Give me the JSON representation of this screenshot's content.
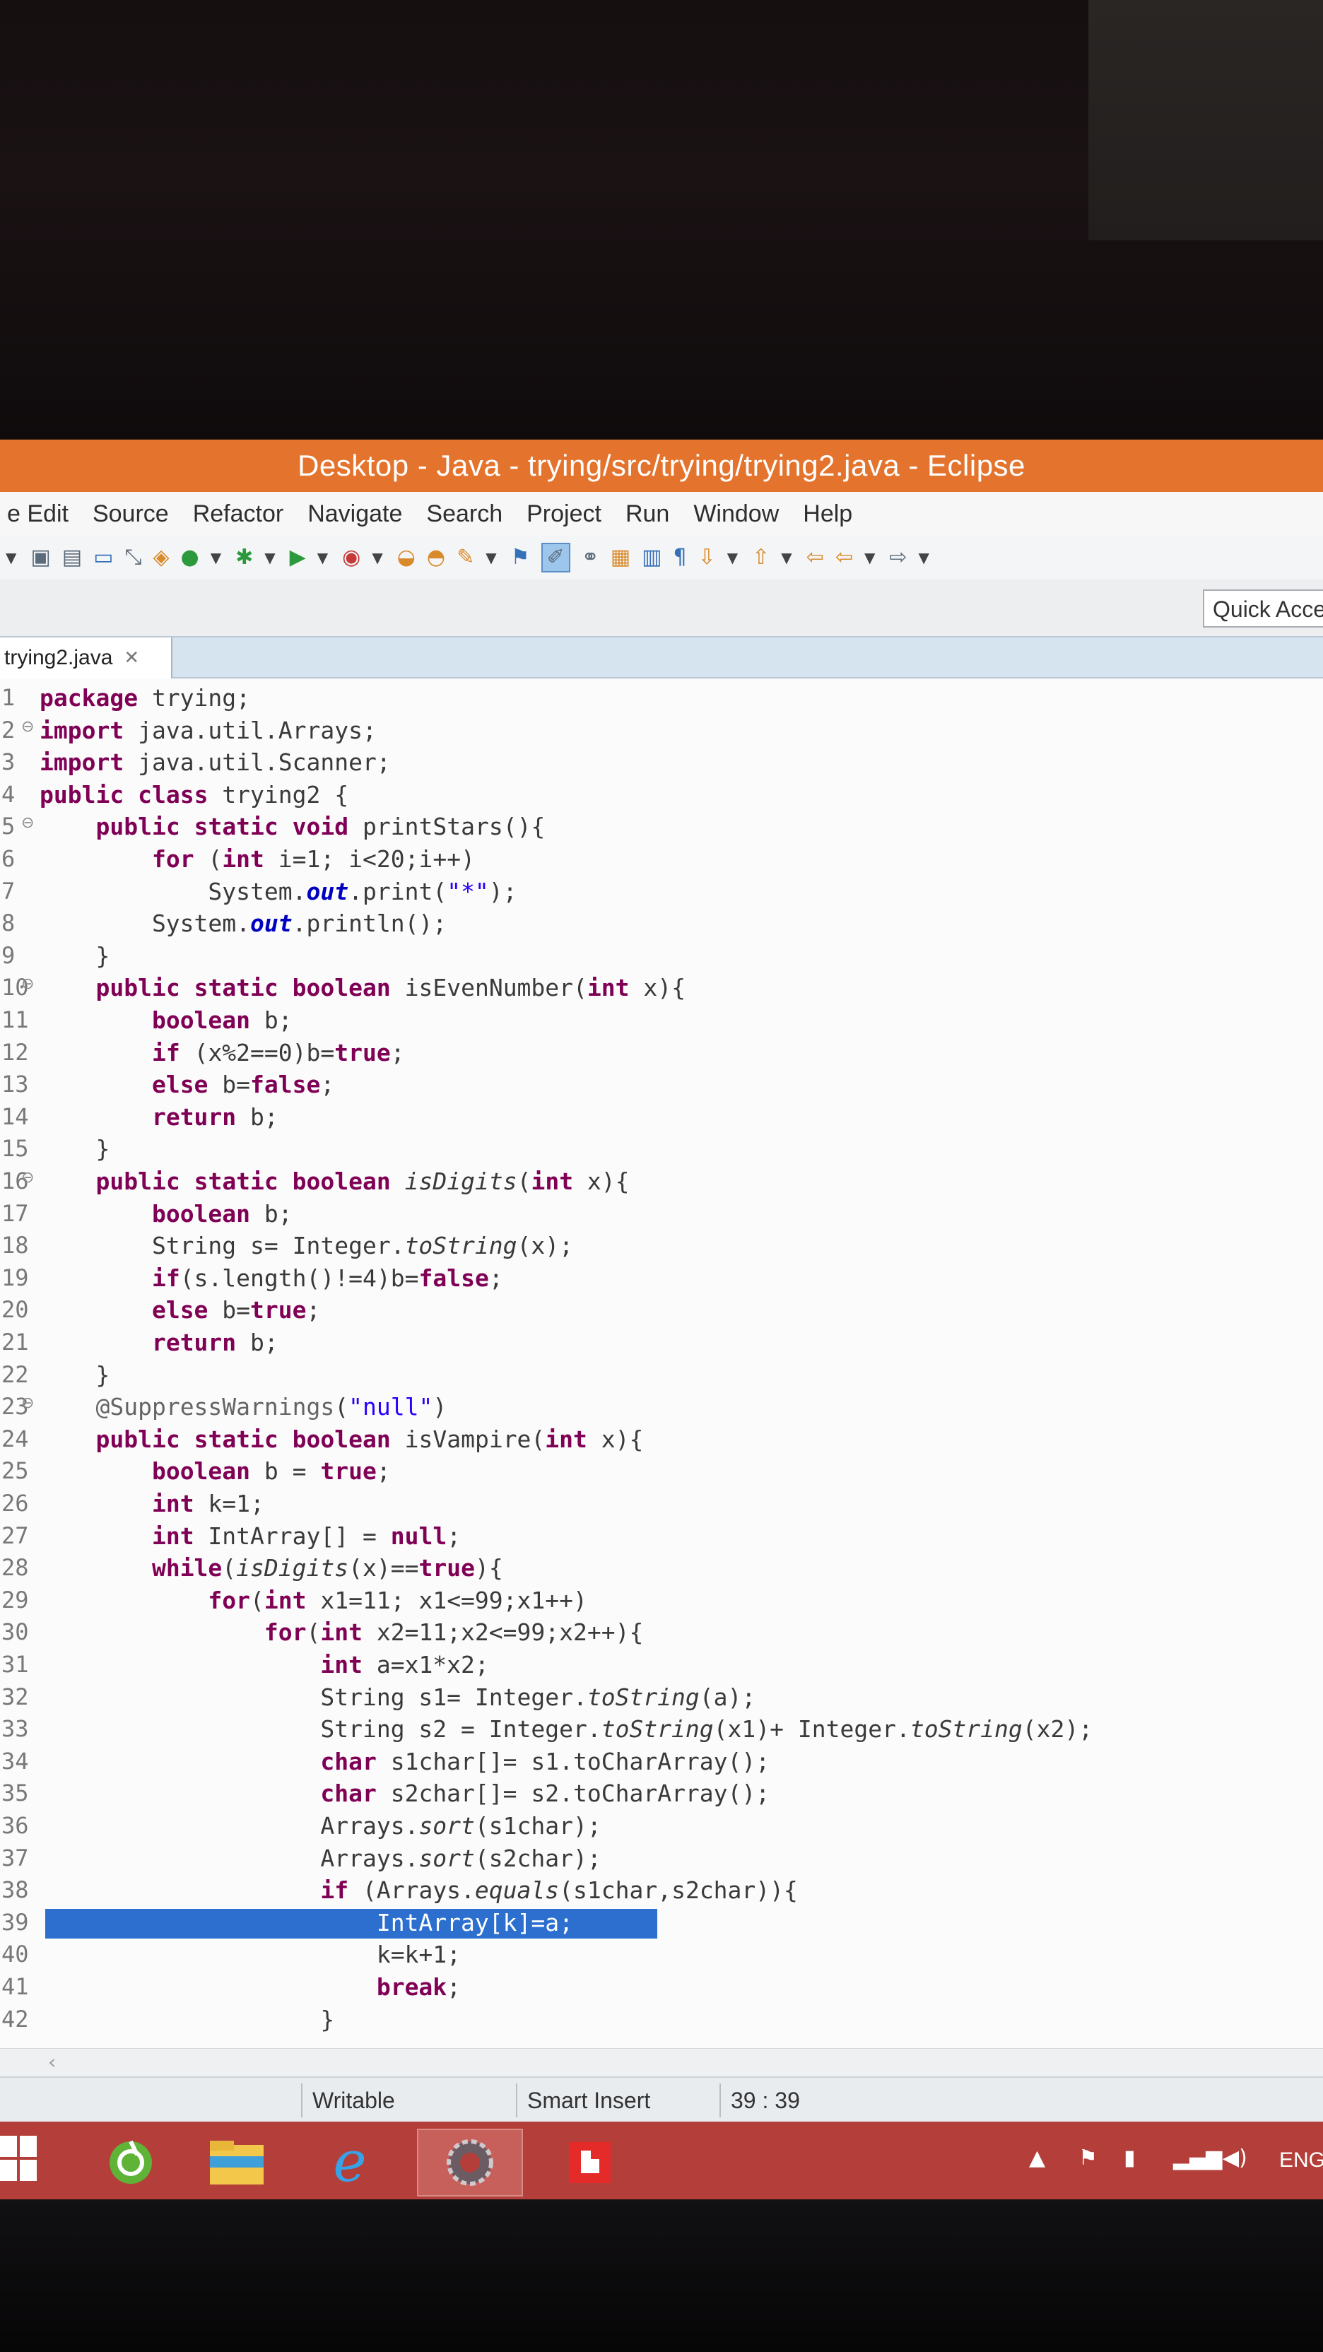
{
  "window": {
    "title": "Desktop - Java - trying/src/trying/trying2.java - Eclipse"
  },
  "menu": [
    "e Edit",
    "Source",
    "Refactor",
    "Navigate",
    "Search",
    "Project",
    "Run",
    "Window",
    "Help"
  ],
  "toolbar": {
    "icons": [
      "new-dropdown-icon",
      "save-icon",
      "save-all-icon",
      "print-icon",
      "skip-breakpoints-icon",
      "new-java-project-icon",
      "new-class-icon",
      "debug-icon",
      "run-icon",
      "external-tools-icon",
      "open-type-icon",
      "open-task-icon",
      "search-icon",
      "toggle-breadcrumb-icon",
      "mark-occurrences-icon",
      "block-selection-icon",
      "show-whitespace-icon",
      "next-annotation-icon",
      "prev-annotation-icon",
      "last-edit-icon",
      "back-icon",
      "forward-icon"
    ]
  },
  "quick_access": {
    "label": "Quick Acce"
  },
  "editor": {
    "tab_label": "trying2.java",
    "tab_close": "✕",
    "lines": [
      {
        "n": "1",
        "fold": "",
        "code": "package trying;"
      },
      {
        "n": "2",
        "fold": "⊖",
        "code": "import java.util.Arrays;"
      },
      {
        "n": "3",
        "fold": "",
        "code": "import java.util.Scanner;"
      },
      {
        "n": "4",
        "fold": "",
        "code": "public class trying2 {"
      },
      {
        "n": "5",
        "fold": "⊖",
        "code": "    public static void printStars(){"
      },
      {
        "n": "6",
        "fold": "",
        "code": "        for (int i=1; i<20;i++)"
      },
      {
        "n": "7",
        "fold": "",
        "code": "            System.out.print(\"*\");"
      },
      {
        "n": "8",
        "fold": "",
        "code": "        System.out.println();"
      },
      {
        "n": "9",
        "fold": "",
        "code": "    }"
      },
      {
        "n": "10",
        "fold": "⊖",
        "code": "    public static boolean isEvenNumber(int x){"
      },
      {
        "n": "11",
        "fold": "",
        "code": "        boolean b;"
      },
      {
        "n": "12",
        "fold": "",
        "code": "        if (x%2==0)b=true;"
      },
      {
        "n": "13",
        "fold": "",
        "code": "        else b=false;"
      },
      {
        "n": "14",
        "fold": "",
        "code": "        return b;"
      },
      {
        "n": "15",
        "fold": "",
        "code": "    }"
      },
      {
        "n": "16",
        "fold": "⊖",
        "code": "    public static boolean isDigits(int x){"
      },
      {
        "n": "17",
        "fold": "",
        "code": "        boolean b;"
      },
      {
        "n": "18",
        "fold": "",
        "code": "        String s= Integer.toString(x);"
      },
      {
        "n": "19",
        "fold": "",
        "code": "        if(s.length()!=4)b=false;"
      },
      {
        "n": "20",
        "fold": "",
        "code": "        else b=true;"
      },
      {
        "n": "21",
        "fold": "",
        "code": "        return b;"
      },
      {
        "n": "22",
        "fold": "",
        "code": "    }"
      },
      {
        "n": "23",
        "fold": "⊖",
        "code": "    @SuppressWarnings(\"null\")"
      },
      {
        "n": "24",
        "fold": "",
        "code": "    public static boolean isVampire(int x){"
      },
      {
        "n": "25",
        "fold": "",
        "code": "        boolean b = true;"
      },
      {
        "n": "26",
        "fold": "",
        "code": "        int k=1;"
      },
      {
        "n": "27",
        "fold": "",
        "code": "        int IntArray[] = null;"
      },
      {
        "n": "28",
        "fold": "",
        "code": "        while(isDigits(x)==true){"
      },
      {
        "n": "29",
        "fold": "",
        "code": "            for(int x1=11; x1<=99;x1++)"
      },
      {
        "n": "30",
        "fold": "",
        "code": "                for(int x2=11;x2<=99;x2++){"
      },
      {
        "n": "31",
        "fold": "",
        "code": "                    int a=x1*x2;"
      },
      {
        "n": "32",
        "fold": "",
        "code": "                    String s1= Integer.toString(a);"
      },
      {
        "n": "33",
        "fold": "",
        "code": "                    String s2 = Integer.toString(x1)+ Integer.toString(x2);"
      },
      {
        "n": "34",
        "fold": "",
        "code": "                    char s1char[]= s1.toCharArray();"
      },
      {
        "n": "35",
        "fold": "",
        "code": "                    char s2char[]= s2.toCharArray();"
      },
      {
        "n": "36",
        "fold": "",
        "code": "                    Arrays.sort(s1char);"
      },
      {
        "n": "37",
        "fold": "",
        "code": "                    Arrays.sort(s2char);"
      },
      {
        "n": "38",
        "fold": "",
        "code": "                    if (Arrays.equals(s1char,s2char)){"
      },
      {
        "n": "39",
        "fold": "",
        "code": "                        IntArray[k]=a;"
      },
      {
        "n": "40",
        "fold": "",
        "code": "                        k=k+1;"
      },
      {
        "n": "41",
        "fold": "",
        "code": "                        break;"
      },
      {
        "n": "42",
        "fold": "",
        "code": "                    }"
      }
    ],
    "highlighted_line": "39"
  },
  "status": {
    "writable": "Writable",
    "insert_mode": "Smart Insert",
    "cursor": "39 : 39"
  },
  "taskbar": {
    "apps": [
      "start-button",
      "browser-app",
      "file-explorer-app",
      "internet-explorer-app",
      "eclipse-app",
      "acrobat-app"
    ],
    "language": "ENG"
  }
}
